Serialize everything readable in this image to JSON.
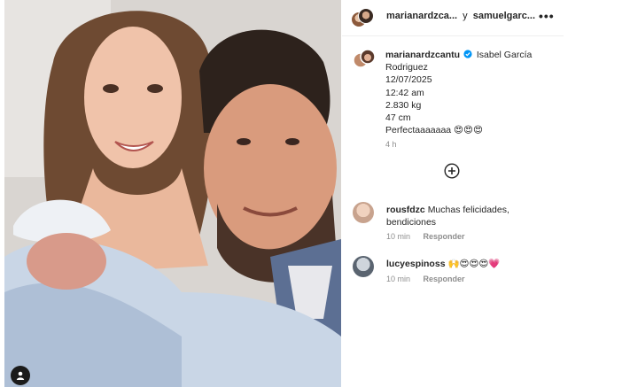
{
  "header": {
    "user1": "marianardzca...",
    "joiner": "y",
    "user2": "samuelgarc...",
    "more_label": "•••"
  },
  "caption": {
    "username": "marianardzcantu",
    "text_first": "Isabel García",
    "lines": [
      "Rodriguez",
      "12/07/2025",
      "12:42 am",
      "2.830 kg",
      "47 cm",
      "Perfectaaaaaaa 😍😍😍"
    ],
    "time": "4 h"
  },
  "comments": [
    {
      "username": "rousfdzc",
      "text": "Muchas felicidades, bendiciones",
      "time": "10 min",
      "reply": "Responder"
    },
    {
      "username": "lucyespinoss",
      "text": "🙌😍😍😍💗",
      "time": "10 min",
      "reply": "Responder"
    }
  ],
  "icons": {
    "verified": "verified-badge-icon",
    "plus": "plus-circle-icon",
    "tag": "user-tag-icon",
    "more": "more-options-icon"
  },
  "colors": {
    "verified": "#0095f6",
    "muted": "#8e8e8e",
    "text": "#262626"
  }
}
